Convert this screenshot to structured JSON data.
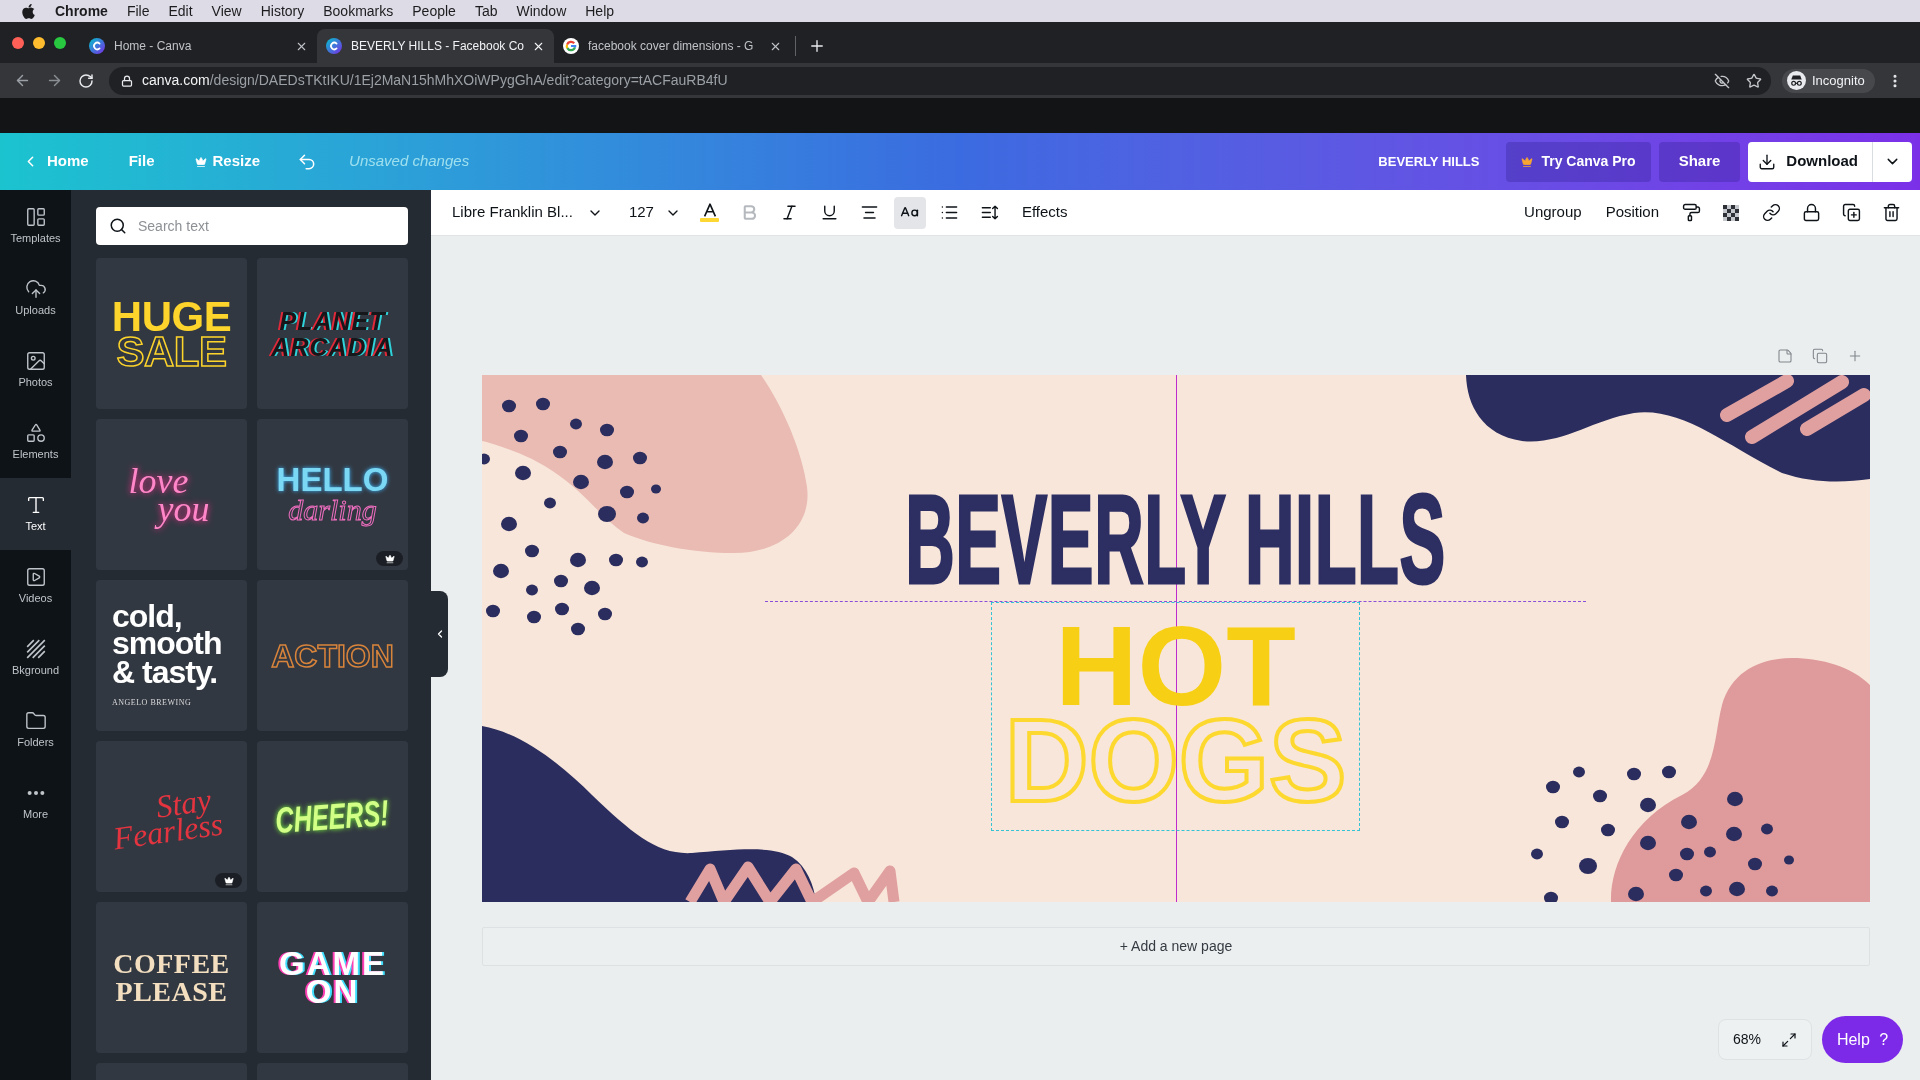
{
  "menu_bar": {
    "app": "Chrome",
    "items": [
      "File",
      "Edit",
      "View",
      "History",
      "Bookmarks",
      "People",
      "Tab",
      "Window",
      "Help"
    ]
  },
  "browser": {
    "tabs": [
      {
        "kind": "design",
        "title": "Home - Canva",
        "selected": false
      },
      {
        "kind": "design",
        "title": "BEVERLY HILLS - Facebook Co",
        "selected": true
      },
      {
        "kind": "search",
        "title": "facebook cover dimensions - G",
        "selected": false
      }
    ],
    "url": {
      "host": "canva.com",
      "path": "/design/DAEDsTKtIKU/1Ej2MaN15hMhXOiWPygGhA/edit?category=tACFauRB4fU"
    },
    "profile": "Incognito"
  },
  "header": {
    "home": "Home",
    "file": "File",
    "resize": "Resize",
    "status": "Unsaved changes",
    "title": "BEVERLY HILLS",
    "pro": "Try Canva Pro",
    "share": "Share",
    "download": "Download"
  },
  "sidebar": {
    "items": [
      {
        "label": "Templates",
        "selected": false
      },
      {
        "label": "Uploads",
        "selected": false
      },
      {
        "label": "Photos",
        "selected": false
      },
      {
        "label": "Elements",
        "selected": false
      },
      {
        "label": "Text",
        "selected": true
      },
      {
        "label": "Videos",
        "selected": false
      },
      {
        "label": "Bkground",
        "selected": false
      },
      {
        "label": "Folders",
        "selected": false
      },
      {
        "label": "More",
        "selected": false
      }
    ]
  },
  "text_panel": {
    "search": {
      "placeholder": "Search text"
    },
    "templates": [
      {
        "kind": "impact",
        "lines": [
          "HUGE",
          "SALE"
        ],
        "pro": false
      },
      {
        "kind": "glitch",
        "lines": [
          "PLANET",
          "ARCADIA"
        ],
        "pro": false
      },
      {
        "kind": "neon",
        "lines": [
          "love",
          "you"
        ],
        "pro": false
      },
      {
        "kind": "gradient",
        "lines": [
          "HELLO",
          "darling"
        ],
        "pro": true
      },
      {
        "kind": "stacked",
        "lines": [
          "cold,",
          "smooth",
          "& tasty.",
          "ANGELO BREWING"
        ],
        "pro": false
      },
      {
        "kind": "outline",
        "lines": [
          "ACTION"
        ],
        "pro": false
      },
      {
        "kind": "script",
        "lines": [
          "Stay",
          "Fearless"
        ],
        "pro": true
      },
      {
        "kind": "glow",
        "lines": [
          "CHEERS!"
        ],
        "pro": false
      },
      {
        "kind": "slab",
        "lines": [
          "COFFEE",
          "PLEASE"
        ],
        "pro": false
      },
      {
        "kind": "arcade",
        "lines": [
          "GAME",
          "ON"
        ],
        "pro": false
      },
      {
        "kind": "clipped"
      },
      {
        "kind": "clipped"
      }
    ]
  },
  "toolbar": {
    "font": "Libre Franklin Bl...",
    "size": "127",
    "tools": [
      {
        "kind": "color",
        "color": "#fdd835",
        "selected": false,
        "disabled": false
      },
      {
        "kind": "bold",
        "selected": false,
        "disabled": true
      },
      {
        "kind": "italic",
        "selected": false,
        "disabled": false
      },
      {
        "kind": "underline",
        "selected": false,
        "disabled": false
      },
      {
        "kind": "align",
        "selected": false,
        "disabled": false
      },
      {
        "kind": "case",
        "selected": true,
        "disabled": false
      },
      {
        "kind": "list",
        "selected": false,
        "disabled": false
      },
      {
        "kind": "spacing",
        "selected": false,
        "disabled": false
      }
    ],
    "effects": "Effects",
    "ungroup": "Ungroup",
    "position": "Position"
  },
  "design": {
    "elements": [
      {
        "kind": "heading",
        "text": "BEVERLY HILLS",
        "selected": false
      },
      {
        "kind": "group",
        "selected": true,
        "lines": [
          {
            "kind": "solid",
            "text": "HOT"
          },
          {
            "kind": "outline",
            "text": "DOGS"
          }
        ]
      }
    ]
  },
  "add_page": "+ Add a new page",
  "zoom": "68%",
  "help": "Help ?"
}
